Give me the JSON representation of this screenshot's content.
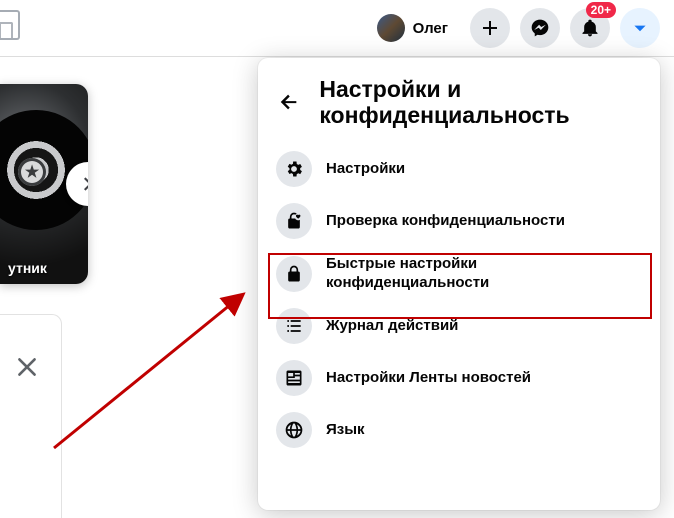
{
  "header": {
    "user_name": "Олег",
    "notification_badge": "20+"
  },
  "story": {
    "caption": "утник"
  },
  "panel": {
    "title": "Настройки и конфиденциальность",
    "items": [
      {
        "label": "Настройки"
      },
      {
        "label": "Проверка конфиденциальности"
      },
      {
        "label": "Быстрые настройки конфиденциальности"
      },
      {
        "label": "Журнал действий"
      },
      {
        "label": "Настройки Ленты новостей"
      },
      {
        "label": "Язык"
      }
    ]
  }
}
